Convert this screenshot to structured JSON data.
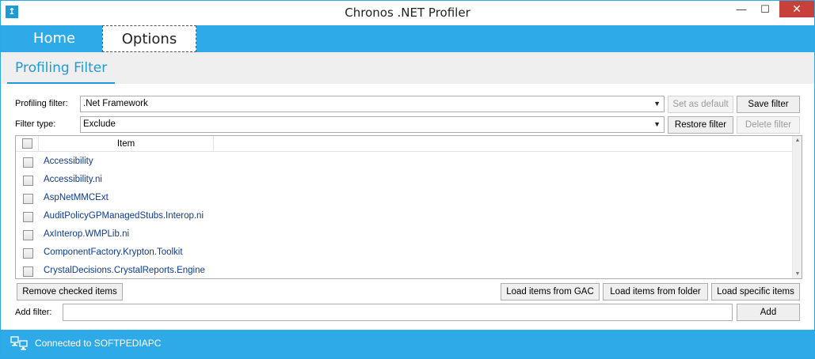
{
  "window": {
    "title": "Chronos .NET Profiler",
    "minimize_glyph": "—",
    "maximize_glyph": "☐",
    "close_glyph": "✕",
    "app_icon": "chronos-app-icon",
    "accent_color": "#2eaae8"
  },
  "tabs": [
    {
      "label": "Home",
      "active": false
    },
    {
      "label": "Options",
      "active": true
    }
  ],
  "section": {
    "title": "Profiling Filter"
  },
  "filter": {
    "profiling_filter_label": "Profiling filter:",
    "profiling_filter_value": ".Net Framework",
    "filter_type_label": "Filter type:",
    "filter_type_value": "Exclude",
    "set_default_label": "Set as default",
    "save_filter_label": "Save filter",
    "restore_filter_label": "Restore filter",
    "delete_filter_label": "Delete filter"
  },
  "list": {
    "column_item": "Item",
    "items": [
      "Accessibility",
      "Accessibility.ni",
      "AspNetMMCExt",
      "AuditPolicyGPManagedStubs.Interop.ni",
      "AxInterop.WMPLib.ni",
      "ComponentFactory.Krypton.Toolkit",
      "CrystalDecisions.CrystalReports.Engine"
    ]
  },
  "actions": {
    "remove_checked_label": "Remove checked items",
    "load_gac_label": "Load items from GAC",
    "load_folder_label": "Load items from folder",
    "load_specific_label": "Load specific items"
  },
  "add_filter": {
    "label": "Add filter:",
    "value": "",
    "add_label": "Add"
  },
  "status": {
    "text": "Connected to SOFTPEDIAPC",
    "icon": "computer-connection-icon"
  }
}
